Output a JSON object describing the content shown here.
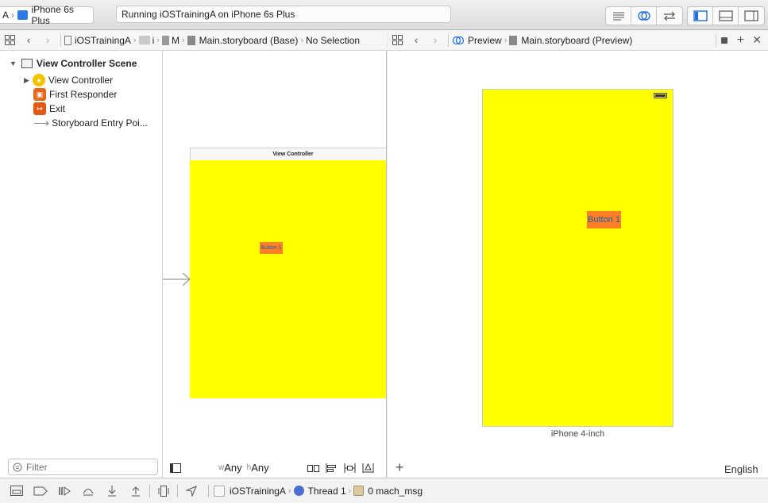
{
  "toolbar": {
    "scheme_partial": "A",
    "device": "iPhone 6s Plus",
    "status": "Running iOSTrainingA on iPhone 6s Plus"
  },
  "left_jump": {
    "crumbs": [
      "iOSTrainingA",
      "i",
      "M",
      "Main.storyboard (Base)",
      "No Selection"
    ]
  },
  "right_jump": {
    "mode": "Preview",
    "file": "Main.storyboard (Preview)"
  },
  "outline": {
    "scene_title": "View Controller Scene",
    "items": [
      {
        "label": "View Controller"
      },
      {
        "label": "First Responder"
      },
      {
        "label": "Exit"
      },
      {
        "label": "Storyboard Entry Poi..."
      }
    ],
    "filter_placeholder": "Filter"
  },
  "canvas": {
    "vc_title": "View Controller",
    "button_label": "Button 1",
    "size_class_w": "Any",
    "size_class_h": "Any",
    "w_prefix": "w",
    "h_prefix": "h"
  },
  "preview": {
    "button_label": "Button 1",
    "device_label": "iPhone 4-inch",
    "language": "English"
  },
  "debug": {
    "target": "iOSTrainingA",
    "thread": "Thread 1",
    "frame": "0 mach_msg"
  },
  "colors": {
    "view_bg": "#ffff00",
    "button_bg": "#ff7f27",
    "accent": "#1c6ee8"
  }
}
